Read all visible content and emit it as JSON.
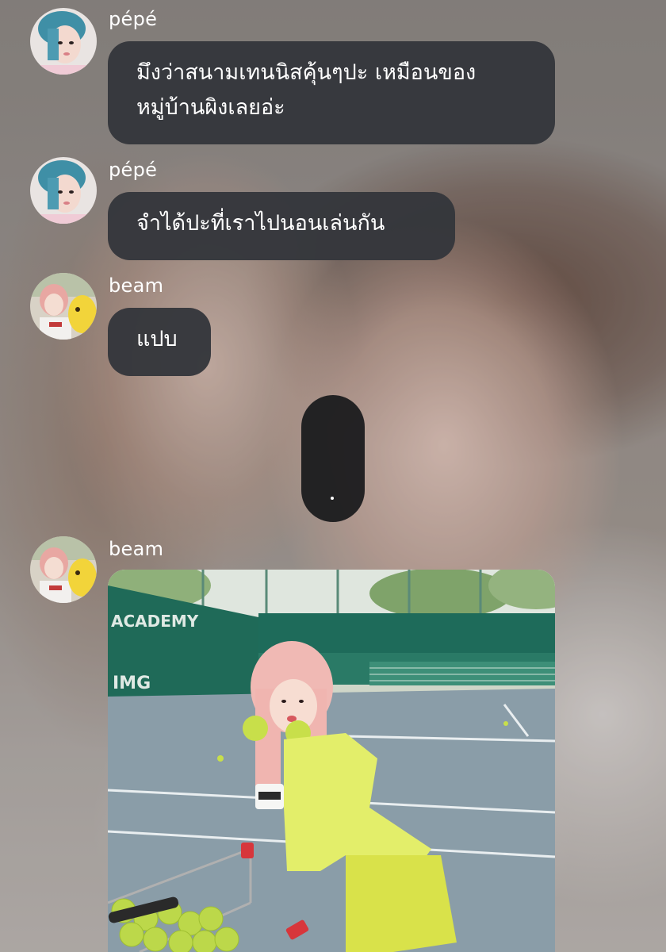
{
  "messages": [
    {
      "sender": "pépé",
      "text_lines": [
        "มึงว่าสนามเทนนิสคุ้นๆปะ เหมือนของ",
        "หมู่บ้านผิงเลยอ่ะ"
      ]
    },
    {
      "sender": "pépé",
      "text": "จำได้ปะที่เราไปนอนเล่นกัน"
    },
    {
      "sender": "beam",
      "text": "แปบ"
    },
    {
      "sender": "beam",
      "photo_sign_text": "ACADEMY",
      "photo_sign_text_2": "IMG"
    }
  ],
  "colors": {
    "bubble": "#34363b",
    "typing_bubble": "#1e1e20",
    "sender_text": "#ffffff",
    "message_text": "#ffffff"
  },
  "icons": {
    "avatar_pepe": "avatar-pepe",
    "avatar_beam": "avatar-beam"
  }
}
